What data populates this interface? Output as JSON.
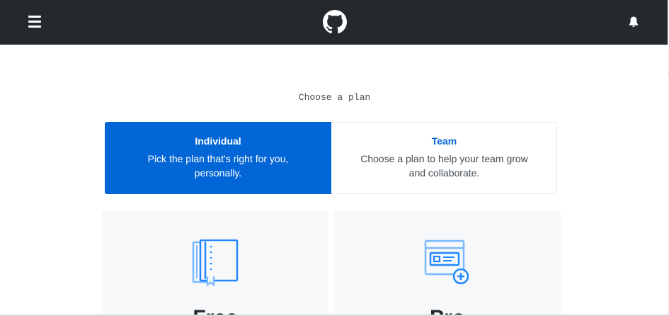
{
  "header": {
    "menu_icon": "hamburger-menu-icon",
    "logo_icon": "github-octocat-logo",
    "notifications_icon": "bell-icon",
    "background_color": "#24292e"
  },
  "heading": "Choose a plan",
  "plan_type_tabs": [
    {
      "title": "Individual",
      "description": "Pick the plan that's right for you, personally.",
      "selected": true
    },
    {
      "title": "Team",
      "description": "Choose a plan to help your team grow and collaborate.",
      "selected": false
    }
  ],
  "plans": [
    {
      "name": "Free",
      "icon": "books-icon"
    },
    {
      "name": "Pro",
      "icon": "id-card-plus-icon"
    }
  ],
  "colors": {
    "accent": "#0366d6",
    "card_background": "#f6f8fa",
    "icon_light": "#79b8ff",
    "icon_dark": "#2188ff"
  }
}
